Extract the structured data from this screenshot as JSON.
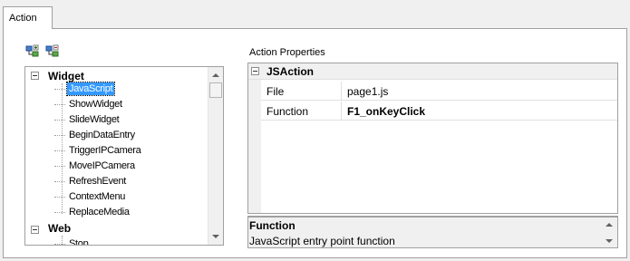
{
  "tab": {
    "label": "Action"
  },
  "toolbar": {
    "add_icon": "add-action-icon",
    "remove_icon": "remove-action-icon"
  },
  "tree": {
    "groups": [
      {
        "label": "Widget",
        "items": [
          "JavaScript",
          "ShowWidget",
          "SlideWidget",
          "BeginDataEntry",
          "TriggerIPCamera",
          "MoveIPCamera",
          "RefreshEvent",
          "ContextMenu",
          "ReplaceMedia"
        ]
      },
      {
        "label": "Web",
        "items": [
          "Stop"
        ]
      }
    ],
    "selected": "JavaScript"
  },
  "properties": {
    "title": "Action Properties",
    "category": "JSAction",
    "rows": [
      {
        "name": "File",
        "value": "page1.js"
      },
      {
        "name": "Function",
        "value": "F1_onKeyClick"
      }
    ]
  },
  "help": {
    "title": "Function",
    "description": "JavaScript entry point function"
  }
}
